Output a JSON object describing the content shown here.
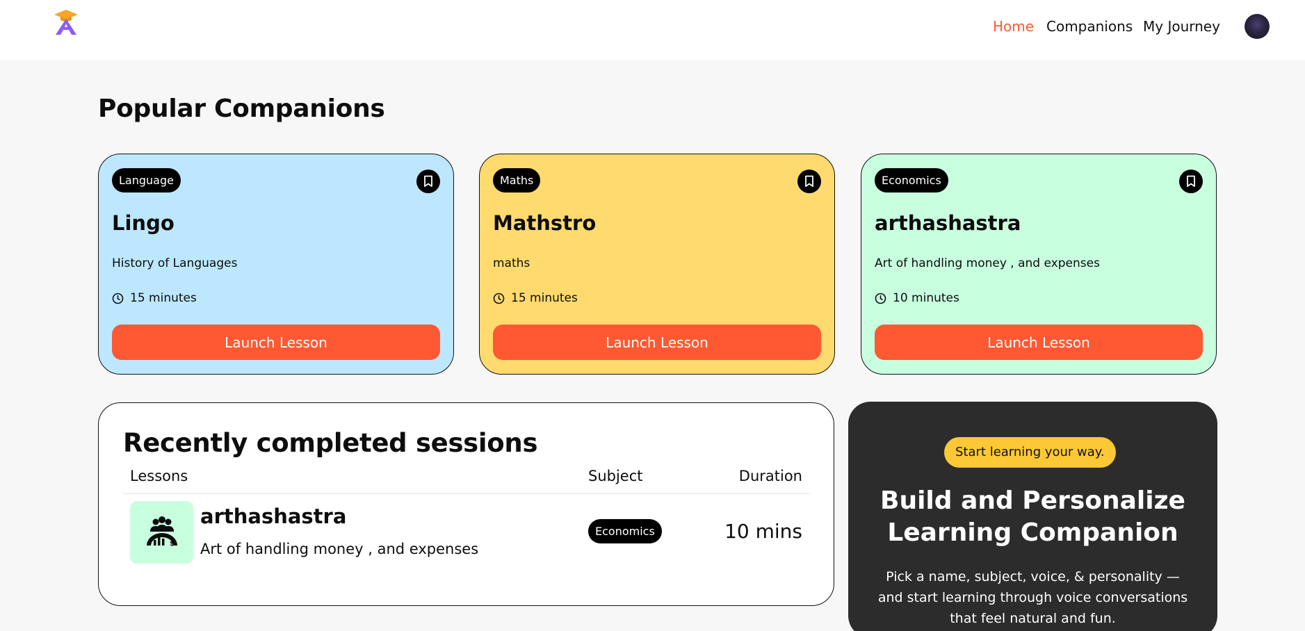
{
  "nav": {
    "logo_icon": "graduation-cap-letter-a-logo",
    "links": [
      "Home",
      "Companions",
      "My Journey"
    ],
    "active": "Home",
    "accent_color": "#fe5933"
  },
  "popular": {
    "title": "Popular Companions",
    "cards": [
      {
        "subject": "Language",
        "name": "Lingo",
        "topic": "History of Languages",
        "duration": "15 minutes",
        "button": "Launch Lesson",
        "color": "#bde7ff"
      },
      {
        "subject": "Maths",
        "name": "Mathstro",
        "topic": "maths",
        "duration": "15 minutes",
        "button": "Launch Lesson",
        "color": "#ffda6e"
      },
      {
        "subject": "Economics",
        "name": "arthashastra",
        "topic": "Art of handling money , and expenses",
        "duration": "10 minutes",
        "button": "Launch Lesson",
        "color": "#c8ffdf"
      }
    ]
  },
  "sessions": {
    "title": "Recently completed sessions",
    "headers": {
      "lessons": "Lessons",
      "subject": "Subject",
      "duration": "Duration"
    },
    "rows": [
      {
        "icon": "economics-people-chart-icon",
        "name": "arthashastra",
        "topic": "Art of handling money , and expenses",
        "subject": "Economics",
        "duration": "10 mins"
      }
    ]
  },
  "cta": {
    "pill": "Start learning your way.",
    "title_line1": "Build and Personalize",
    "title_line2": "Learning Companion",
    "description": "Pick a name, subject, voice, & personality — and start learning through voice conversations that feel natural and fun."
  }
}
